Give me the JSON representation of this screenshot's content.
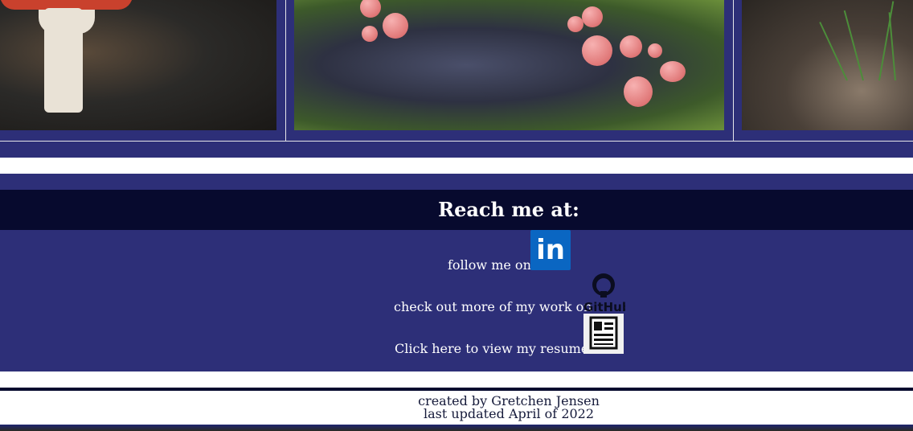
{
  "gallery": {
    "images": [
      {
        "name": "mushroom-photo-amanita"
      },
      {
        "name": "mushroom-photo-pink-slime-mold"
      },
      {
        "name": "mushroom-photo-forest-floor"
      }
    ]
  },
  "contact": {
    "title": "Reach me at:",
    "linkedin_text": "follow me on",
    "github_text": "check out more of my work on",
    "resume_text": "Click here to view my resume:",
    "linkedin_icon": "linkedin-icon",
    "github_icon": "github-icon",
    "resume_icon": "resume-icon",
    "github_wordmark": "GitHub",
    "linkedin_mark": "in"
  },
  "footer": {
    "line1": "created by Gretchen Jensen",
    "line2": "last updated April of 2022"
  },
  "colors": {
    "navy": "#2d2f78",
    "dark_header": "#070a2e",
    "linkedin_blue": "#0a66c2"
  }
}
